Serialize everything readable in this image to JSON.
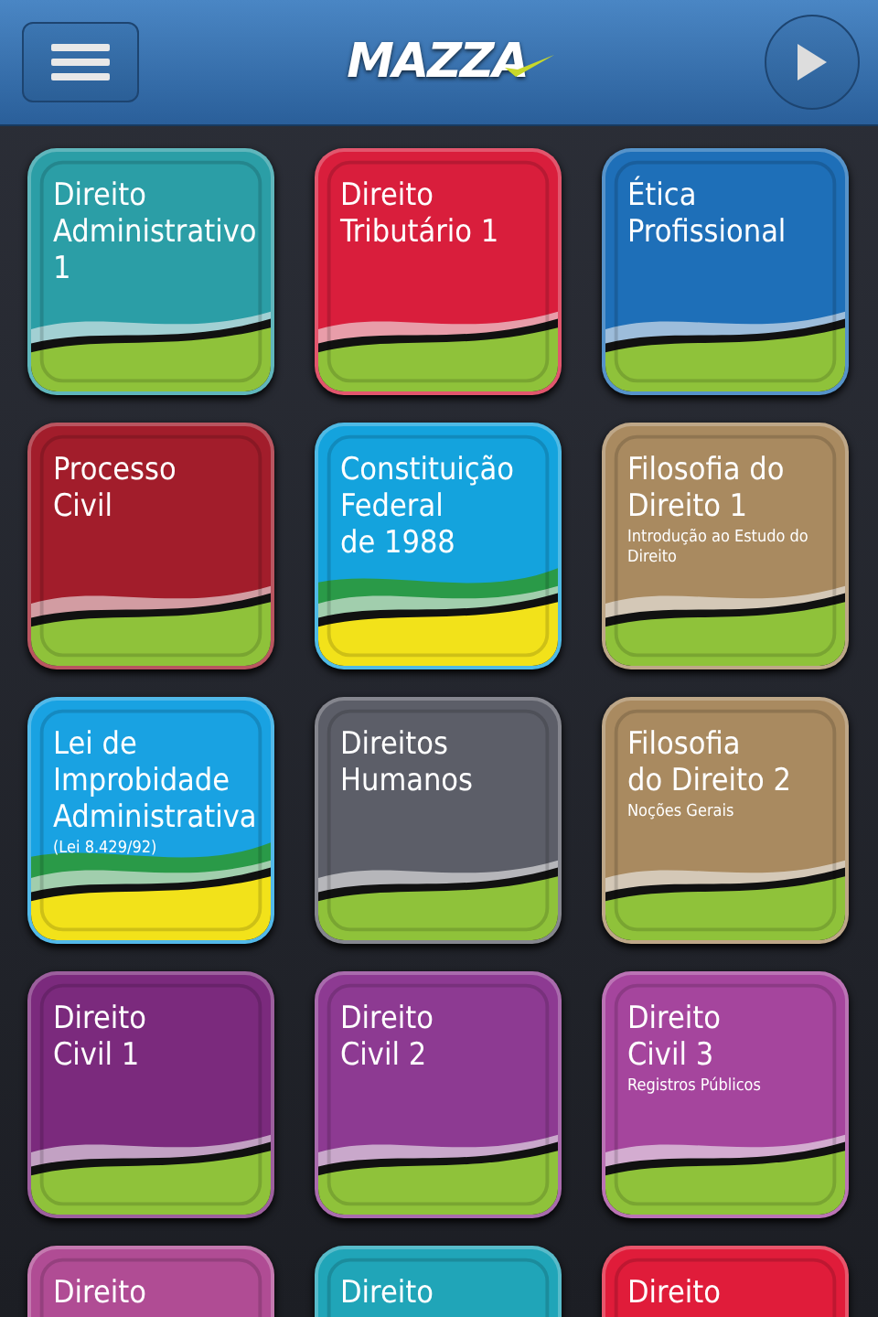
{
  "header": {
    "logo": "MAZZA"
  },
  "tiles": [
    {
      "title": [
        "Direito",
        "Administrativo",
        "1"
      ],
      "color": "#2b9ea6",
      "yellow_ground": false
    },
    {
      "title": [
        "Direito",
        "Tributário 1"
      ],
      "color": "#d91e3c",
      "yellow_ground": false
    },
    {
      "title": [
        "Ética",
        "Profissional"
      ],
      "color": "#1e6fb8",
      "yellow_ground": false
    },
    {
      "title": [
        "Processo",
        "Civil"
      ],
      "color": "#a21d2b",
      "yellow_ground": false
    },
    {
      "title": [
        "Constituição",
        "Federal",
        "de 1988"
      ],
      "color": "#14a3dd",
      "yellow_ground": true
    },
    {
      "title": [
        "Filosofia do",
        "Direito 1"
      ],
      "subtitle": "Introdução ao Estudo do Direito",
      "color": "#a98a60",
      "yellow_ground": false
    },
    {
      "title": [
        "Lei de",
        "Improbidade",
        "Administrativa"
      ],
      "subtitle": "(Lei 8.429/92)",
      "color": "#19a2e2",
      "yellow_ground": true
    },
    {
      "title": [
        "Direitos",
        "Humanos"
      ],
      "color": "#5c5e68",
      "yellow_ground": false
    },
    {
      "title": [
        "Filosofia",
        "do Direito 2"
      ],
      "subtitle": "Noções Gerais",
      "color": "#a98a60",
      "yellow_ground": false
    },
    {
      "title": [
        "Direito",
        "Civil 1"
      ],
      "color": "#7b2a7d",
      "yellow_ground": false
    },
    {
      "title": [
        "Direito",
        "Civil 2"
      ],
      "color": "#8d3a92",
      "yellow_ground": false
    },
    {
      "title": [
        "Direito",
        "Civil 3"
      ],
      "subtitle": "Registros Públicos",
      "color": "#a5459d",
      "yellow_ground": false
    },
    {
      "title": [
        "Direito"
      ],
      "color": "#b04c94"
    },
    {
      "title": [
        "Direito"
      ],
      "color": "#20a5b8"
    },
    {
      "title": [
        "Direito"
      ],
      "color": "#e01c3a"
    }
  ]
}
